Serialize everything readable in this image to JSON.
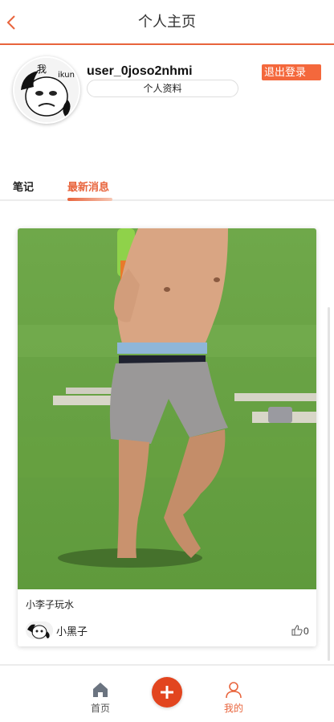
{
  "header": {
    "title": "个人主页",
    "back_icon": "chevron-left-icon"
  },
  "profile": {
    "username": "user_0joso2nhmi",
    "profile_button": "个人资料",
    "logout_button": "退出登录",
    "avatar_text": "我ikun"
  },
  "tabs": [
    {
      "label": "笔记",
      "active": false
    },
    {
      "label": "最新消息",
      "active": true
    }
  ],
  "post": {
    "title": "小李子玩水",
    "author": "小黑子",
    "likes": "0"
  },
  "bottom_nav": {
    "home": "首页",
    "add": "add-icon",
    "mine": "我的"
  },
  "colors": {
    "accent": "#e8643c",
    "logout_bg": "#f4683c",
    "add_button": "#e2451f"
  }
}
